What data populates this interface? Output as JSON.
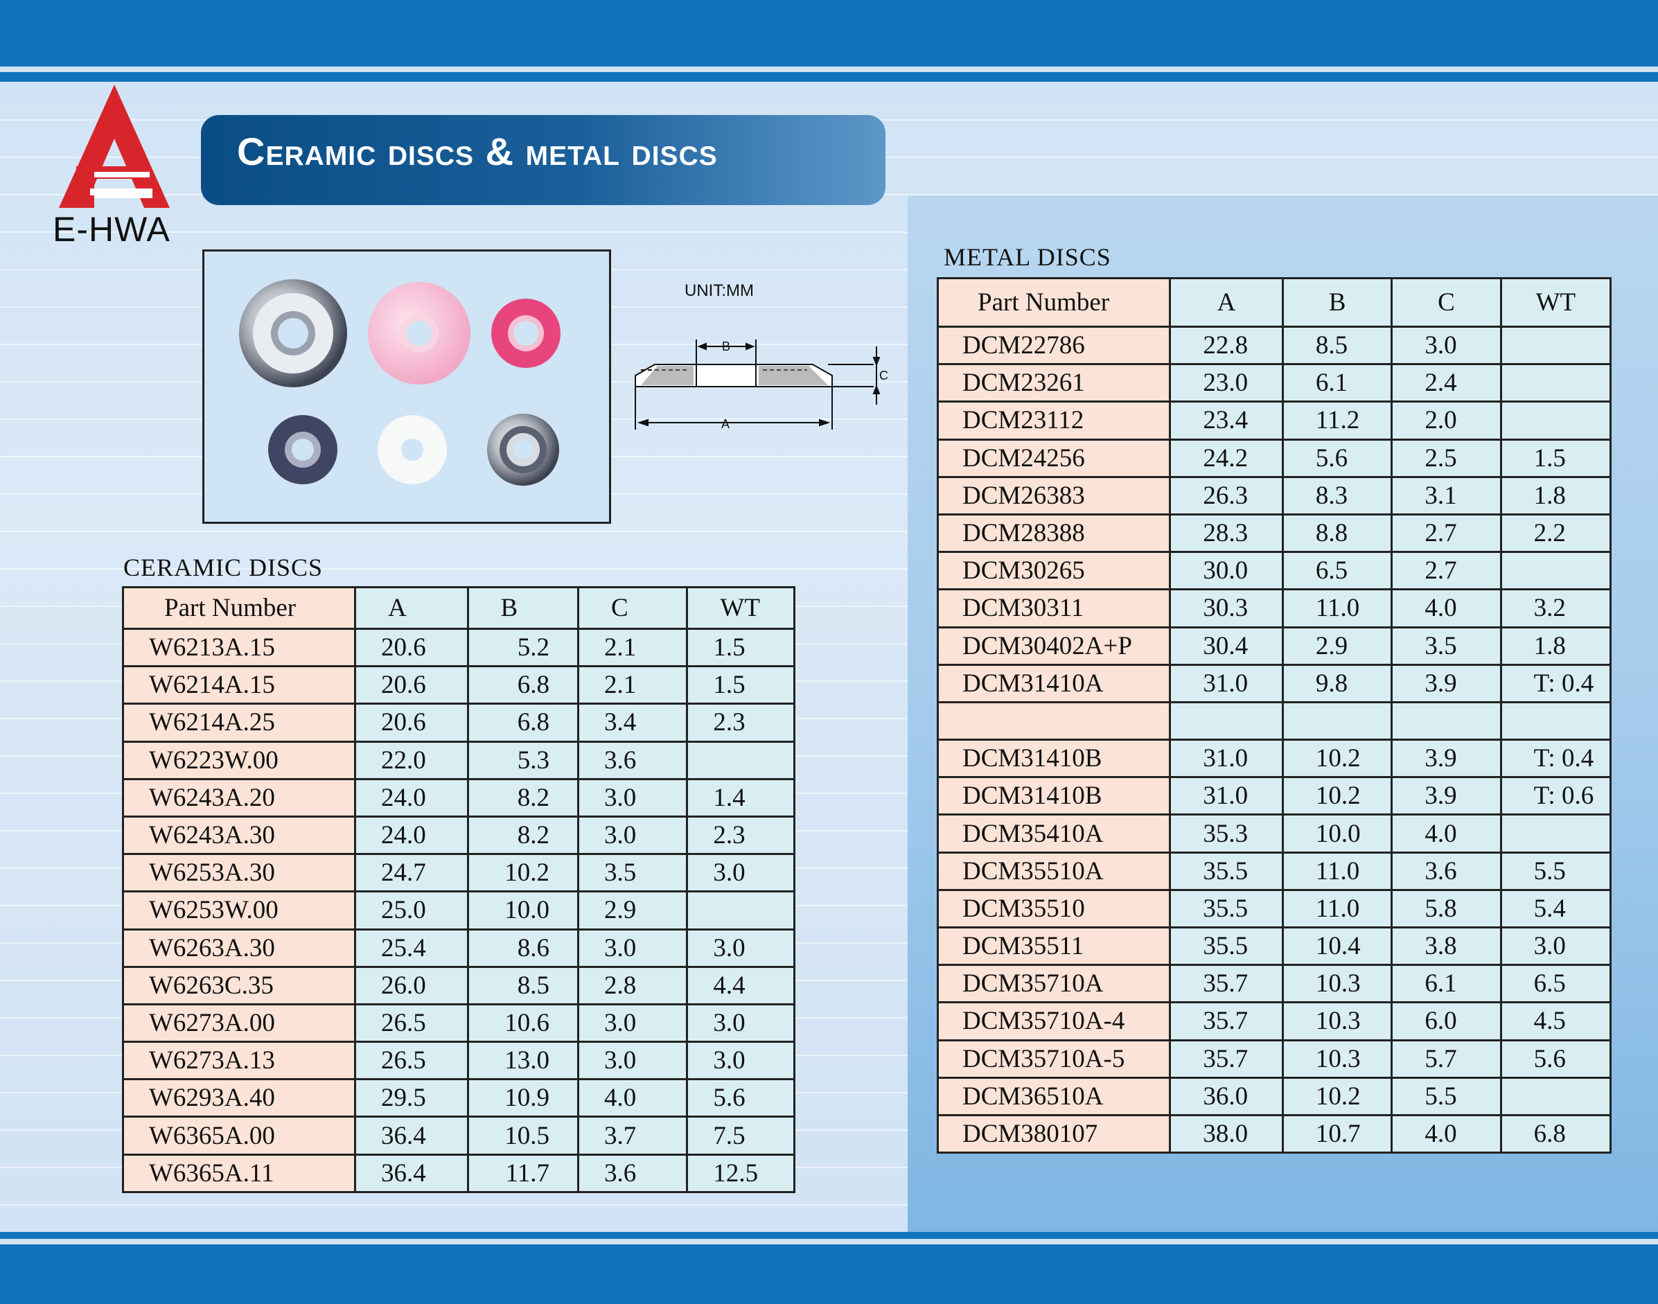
{
  "brand": {
    "name": "E-HWA",
    "logo_letter": "E",
    "logo_color": "#d7252b"
  },
  "title": "Ceramic discs & metal discs",
  "unit_label": "UNIT:MM",
  "diagram": {
    "label_a": "A",
    "label_b": "B",
    "label_c": "C"
  },
  "ceramic": {
    "heading": "CERAMIC DISCS",
    "columns": [
      "Part  Number",
      "A",
      "B",
      "C",
      "WT"
    ],
    "rows": [
      [
        "W6213A.15",
        "20.6",
        "5.2",
        "2.1",
        "1.5"
      ],
      [
        "W6214A.15",
        "20.6",
        "6.8",
        "2.1",
        "1.5"
      ],
      [
        "W6214A.25",
        "20.6",
        "6.8",
        "3.4",
        "2.3"
      ],
      [
        "W6223W.00",
        "22.0",
        "5.3",
        "3.6",
        ""
      ],
      [
        "W6243A.20",
        "24.0",
        "8.2",
        "3.0",
        "1.4"
      ],
      [
        "W6243A.30",
        "24.0",
        "8.2",
        "3.0",
        "2.3"
      ],
      [
        "W6253A.30",
        "24.7",
        "10.2",
        "3.5",
        "3.0"
      ],
      [
        "W6253W.00",
        "25.0",
        "10.0",
        "2.9",
        ""
      ],
      [
        "W6263A.30",
        "25.4",
        "8.6",
        "3.0",
        "3.0"
      ],
      [
        "W6263C.35",
        "26.0",
        "8.5",
        "2.8",
        "4.4"
      ],
      [
        "W6273A.00",
        "26.5",
        "10.6",
        "3.0",
        "3.0"
      ],
      [
        "W6273A.13",
        "26.5",
        "13.0",
        "3.0",
        "3.0"
      ],
      [
        "W6293A.40",
        "29.5",
        "10.9",
        "4.0",
        "5.6"
      ],
      [
        "W6365A.00",
        "36.4",
        "10.5",
        "3.7",
        "7.5"
      ],
      [
        "W6365A.11",
        "36.4",
        "11.7",
        "3.6",
        "12.5"
      ]
    ]
  },
  "metal": {
    "heading": "METAL DISCS",
    "columns": [
      "Part  Number",
      "A",
      "B",
      "C",
      "WT"
    ],
    "rows": [
      [
        "DCM22786",
        "22.8",
        "8.5",
        "3.0",
        ""
      ],
      [
        "DCM23261",
        "23.0",
        "6.1",
        "2.4",
        ""
      ],
      [
        "DCM23112",
        "23.4",
        "11.2",
        "2.0",
        ""
      ],
      [
        "DCM24256",
        "24.2",
        "5.6",
        "2.5",
        "1.5"
      ],
      [
        "DCM26383",
        "26.3",
        "8.3",
        "3.1",
        "1.8"
      ],
      [
        "DCM28388",
        "28.3",
        "8.8",
        "2.7",
        "2.2"
      ],
      [
        "DCM30265",
        "30.0",
        "6.5",
        "2.7",
        ""
      ],
      [
        "DCM30311",
        "30.3",
        "11.0",
        "4.0",
        "3.2"
      ],
      [
        "DCM30402A+P",
        "30.4",
        "2.9",
        "3.5",
        "1.8"
      ],
      [
        "DCM31410A",
        "31.0",
        "9.8",
        "3.9",
        "T: 0.4"
      ],
      [
        "",
        "",
        "",
        "",
        ""
      ],
      [
        "DCM31410B",
        "31.0",
        "10.2",
        "3.9",
        "T: 0.4"
      ],
      [
        "DCM31410B",
        "31.0",
        "10.2",
        "3.9",
        "T: 0.6"
      ],
      [
        "DCM35410A",
        "35.3",
        "10.0",
        "4.0",
        ""
      ],
      [
        "DCM35510A",
        "35.5",
        "11.0",
        "3.6",
        "5.5"
      ],
      [
        "DCM35510",
        "35.5",
        "11.0",
        "5.8",
        "5.4"
      ],
      [
        "DCM35511",
        "35.5",
        "10.4",
        "3.8",
        "3.0"
      ],
      [
        "DCM35710A",
        "35.7",
        "10.3",
        "6.1",
        "6.5"
      ],
      [
        "DCM35710A-4",
        "35.7",
        "10.3",
        "6.0",
        "4.5"
      ],
      [
        "DCM35710A-5",
        "35.7",
        "10.3",
        "5.7",
        "5.6"
      ],
      [
        "DCM36510A",
        "36.0",
        "10.2",
        "5.5",
        ""
      ],
      [
        "DCM380107",
        "38.0",
        "10.7",
        "4.0",
        "6.8"
      ]
    ]
  },
  "photo": {
    "items": [
      "metal-disc",
      "pink-ceramic-disc",
      "red-ceramic-disc",
      "dark-ceramic-disc",
      "white-ceramic-disc",
      "metal-disc-small"
    ]
  }
}
